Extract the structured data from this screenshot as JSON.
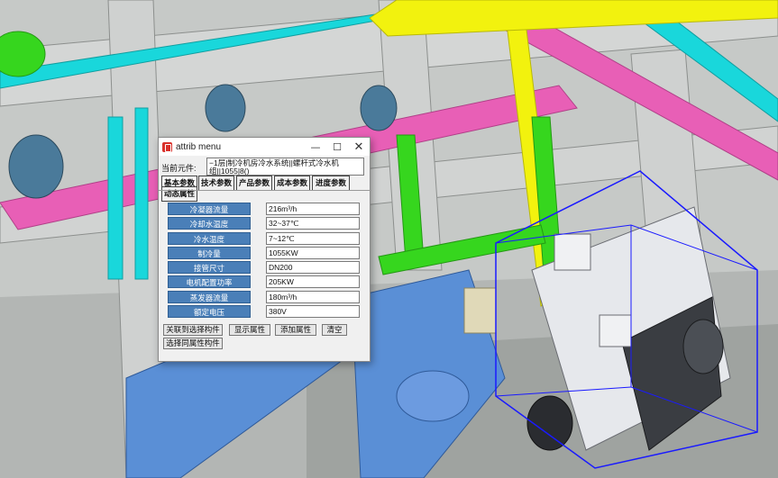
{
  "window": {
    "title": "attrib menu",
    "controls": {
      "minimize": "—",
      "maximize": "☐",
      "close": "✕"
    }
  },
  "current_component": {
    "label": "当前元件:",
    "value": "−1层|制冷机房冷水系统||螺杆式冷水机组||1055|8()"
  },
  "tabs": [
    {
      "label": "基本参数",
      "active": true
    },
    {
      "label": "技术参数",
      "active": false
    },
    {
      "label": "产品参数",
      "active": false
    },
    {
      "label": "成本参数",
      "active": false
    },
    {
      "label": "进度参数",
      "active": false
    },
    {
      "label": "动态属性",
      "active": false
    }
  ],
  "params": [
    {
      "label": "冷凝器流量",
      "value": "216m³/h"
    },
    {
      "label": "冷却水温度",
      "value": "32~37℃"
    },
    {
      "label": "冷水温度",
      "value": "7~12℃"
    },
    {
      "label": "制冷量",
      "value": "1055KW"
    },
    {
      "label": "接管尺寸",
      "value": "DN200"
    },
    {
      "label": "电机配置功率",
      "value": "205KW"
    },
    {
      "label": "蒸发器流量",
      "value": "180m³/h"
    },
    {
      "label": "额定电压",
      "value": "380V"
    }
  ],
  "buttons": {
    "link_to_selection": "关联到选择构件",
    "show_attrs": "显示属性",
    "add_attrs": "添加属性",
    "clear": "清空",
    "select_same_attrs": "选择同属性构件"
  },
  "colors": {
    "pipe_magenta": "#e85fb6",
    "pipe_cyan": "#19d7db",
    "pipe_yellow": "#f2f20e",
    "pipe_green": "#36d61e",
    "equipment_blue": "#5a8fd6",
    "selection_box": "#1a1aff",
    "param_label_bg": "#4a7fb8"
  }
}
